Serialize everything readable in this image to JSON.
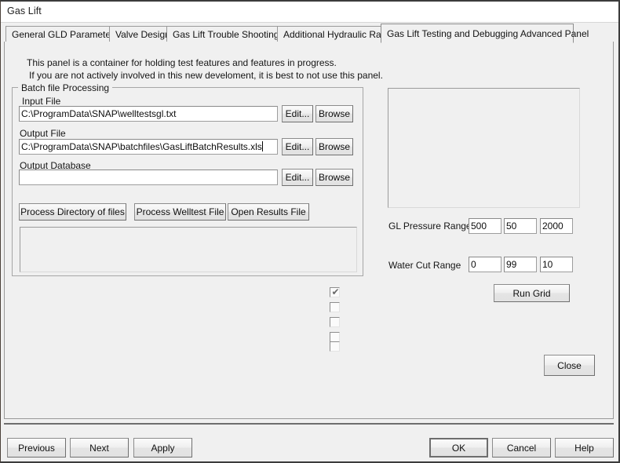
{
  "window": {
    "title": "Gas Lift"
  },
  "tabs": [
    {
      "label": "General GLD Parameters",
      "selected": false
    },
    {
      "label": "Valve Design",
      "selected": false
    },
    {
      "label": "Gas Lift Trouble Shooting",
      "selected": false
    },
    {
      "label": "Additional Hydraulic Rates",
      "selected": false
    },
    {
      "label": "Gas Lift Testing and Debugging Advanced Panel",
      "selected": true
    }
  ],
  "panel": {
    "note_line1": "This panel is a container for holding test features and features in progress.",
    "note_line2": "If you are not actively involved in this new develoment, it is best to not use this panel."
  },
  "batch_group": {
    "legend": "Batch file Processing",
    "input_file": {
      "label": "Input File",
      "value": "C:\\ProgramData\\SNAP\\welltestsgl.txt",
      "placeholder": "",
      "edit_label": "Edit...",
      "browse_label": "Browse"
    },
    "output_file": {
      "label": "Output File",
      "value": "C:\\ProgramData\\SNAP\\batchfiles\\GasLiftBatchResults.xls",
      "placeholder": "",
      "edit_label": "Edit...",
      "browse_label": "Browse"
    },
    "output_database": {
      "label": "Output Database",
      "value": "",
      "placeholder": "",
      "edit_label": "Edit...",
      "browse_label": "Browse"
    },
    "actions": {
      "process_directory": "Process Directory of files",
      "process_welltest": "Process Welltest File",
      "open_results": "Open Results File"
    },
    "log_box": ""
  },
  "checkboxes": [
    {
      "checked": true,
      "glyph": "✔"
    },
    {
      "checked": false,
      "glyph": ""
    },
    {
      "checked": false,
      "glyph": ""
    },
    {
      "checked": false,
      "glyph": ""
    },
    {
      "checked": false,
      "glyph": ""
    }
  ],
  "grid_panel": {
    "preview_box": "",
    "gl_pressure_range": {
      "label": "GL Pressure Range",
      "start": "500",
      "step": "50",
      "end": "2000"
    },
    "water_cut_range": {
      "label": "Water Cut Range",
      "start": "0",
      "step": "99",
      "end": "10"
    },
    "run_grid_label": "Run Grid",
    "close_label": "Close"
  },
  "footer": {
    "previous_label": "Previous",
    "next_label": "Next",
    "apply_label": "Apply",
    "ok_label": "OK",
    "cancel_label": "Cancel",
    "help_label": "Help"
  },
  "colors": {
    "face": "#f0f0f0",
    "field": "#ffffff",
    "border": "#9a9a9a",
    "text": "#151515"
  }
}
